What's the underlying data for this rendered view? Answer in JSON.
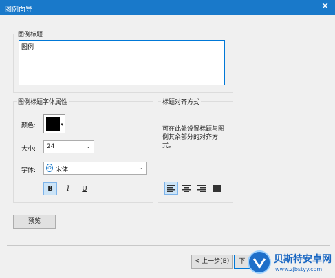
{
  "window": {
    "title": "图例向导",
    "close_glyph": "✕"
  },
  "title_group": {
    "label": "图例标题",
    "value": "图例"
  },
  "font_group": {
    "label": "图例标题字体属性",
    "color_label": "颜色:",
    "color_value": "#000000",
    "size_label": "大小:",
    "size_value": "24",
    "font_label": "字体:",
    "font_value": "宋体",
    "bold": "B",
    "italic": "I",
    "underline": "U"
  },
  "align_group": {
    "label": "标题对齐方式",
    "description": "可在此处设置标题与图例其余部分的对齐方式。",
    "options": [
      "left-align-icon",
      "center-align-icon",
      "right-align-icon",
      "justify-align-icon"
    ],
    "selected": "left-align-icon"
  },
  "buttons": {
    "preview": "预览",
    "back": "< 上一步(B)",
    "next": "下"
  },
  "watermark": {
    "text": "贝斯特安卓网",
    "url": "www.zjbstyy.com"
  }
}
